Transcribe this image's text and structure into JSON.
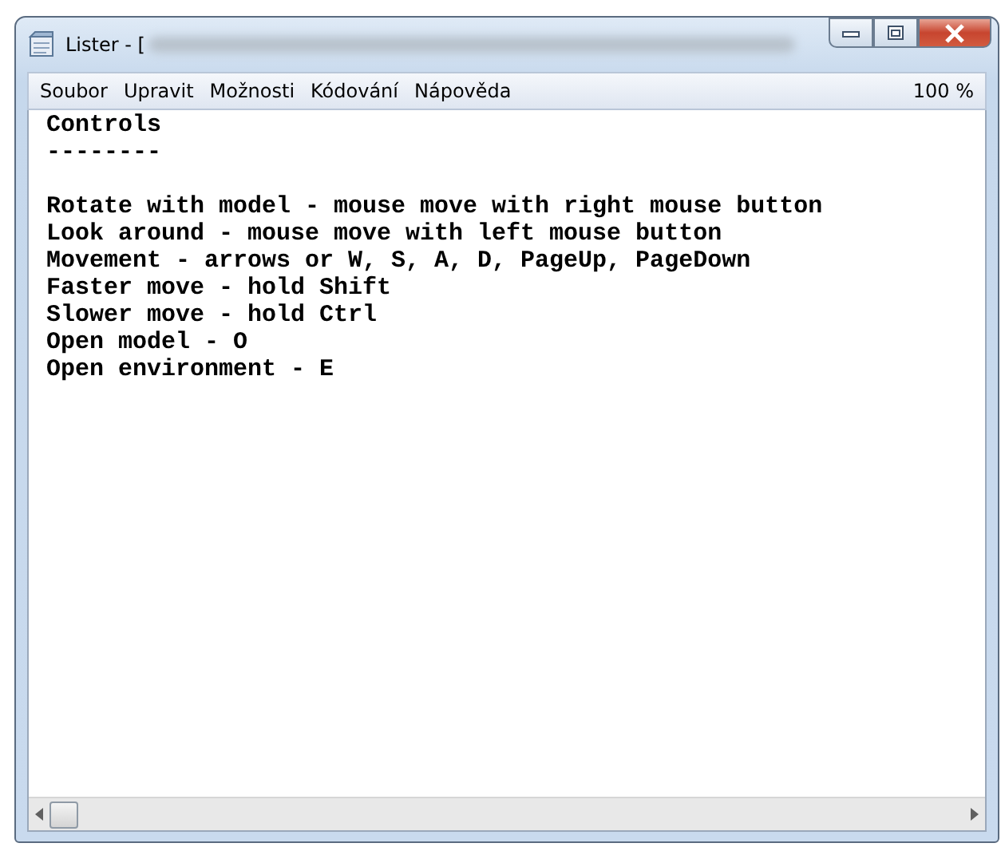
{
  "window": {
    "title": "Lister - ["
  },
  "menu": [
    {
      "label": "Soubor"
    },
    {
      "label": "Upravit"
    },
    {
      "label": "Možnosti"
    },
    {
      "label": "Kódování"
    },
    {
      "label": "Nápověda"
    }
  ],
  "zoom": "100 %",
  "document": {
    "heading": "Controls",
    "rule": "--------",
    "lines": [
      "Rotate with model - mouse move with right mouse button",
      "Look around - mouse move with left mouse button",
      "Movement - arrows or W, S, A, D, PageUp, PageDown",
      "Faster move - hold Shift",
      "Slower move - hold Ctrl",
      "Open model - O",
      "Open environment - E"
    ]
  }
}
